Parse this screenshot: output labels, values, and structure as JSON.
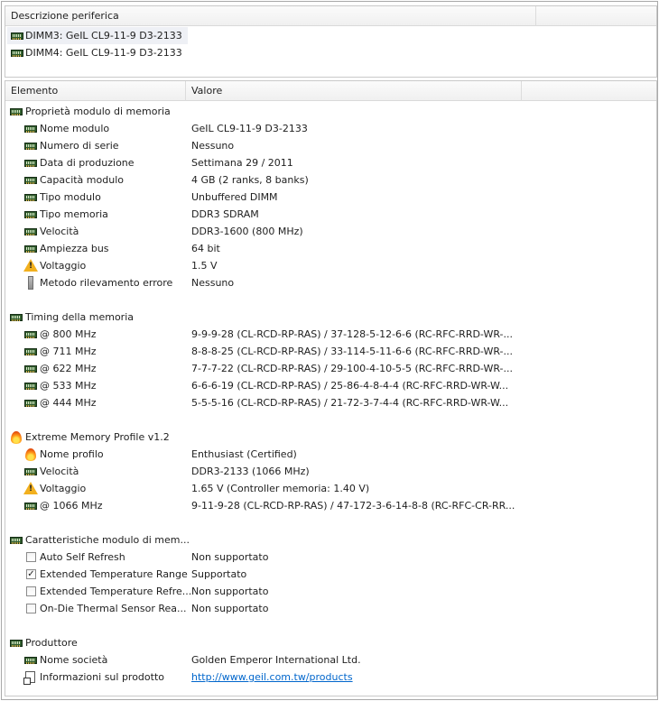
{
  "device_pane": {
    "header": "Descrizione periferica",
    "devices": [
      "DIMM3: GeIL CL9-11-9 D3-2133",
      "DIMM4: GeIL CL9-11-9 D3-2133"
    ]
  },
  "list_pane": {
    "headers": {
      "element": "Elemento",
      "value": "Valore"
    },
    "sections": [
      {
        "title": "Proprietà modulo di memoria",
        "icon": "memory-module-icon",
        "rows": [
          {
            "label": "Nome modulo",
            "value": "GeIL CL9-11-9 D3-2133",
            "icon": "memory-module-icon"
          },
          {
            "label": "Numero di serie",
            "value": "Nessuno",
            "icon": "memory-module-icon"
          },
          {
            "label": "Data di produzione",
            "value": "Settimana 29 / 2011",
            "icon": "memory-module-icon"
          },
          {
            "label": "Capacità modulo",
            "value": "4 GB (2 ranks, 8 banks)",
            "icon": "memory-module-icon"
          },
          {
            "label": "Tipo modulo",
            "value": "Unbuffered DIMM",
            "icon": "memory-module-icon"
          },
          {
            "label": "Tipo memoria",
            "value": "DDR3 SDRAM",
            "icon": "memory-module-icon"
          },
          {
            "label": "Velocità",
            "value": "DDR3-1600 (800 MHz)",
            "icon": "memory-module-icon"
          },
          {
            "label": "Ampiezza bus",
            "value": "64 bit",
            "icon": "memory-module-icon"
          },
          {
            "label": "Voltaggio",
            "value": "1.5 V",
            "icon": "warning-icon"
          },
          {
            "label": "Metodo rilevamento errore",
            "value": "Nessuno",
            "icon": "pencil-icon"
          }
        ]
      },
      {
        "title": "Timing della memoria",
        "icon": "memory-module-icon",
        "rows": [
          {
            "label": "@ 800 MHz",
            "value": "9-9-9-28  (CL-RCD-RP-RAS) / 37-128-5-12-6-6  (RC-RFC-RRD-WR-...",
            "icon": "memory-module-icon"
          },
          {
            "label": "@ 711 MHz",
            "value": "8-8-8-25  (CL-RCD-RP-RAS) / 33-114-5-11-6-6  (RC-RFC-RRD-WR-...",
            "icon": "memory-module-icon"
          },
          {
            "label": "@ 622 MHz",
            "value": "7-7-7-22  (CL-RCD-RP-RAS) / 29-100-4-10-5-5  (RC-RFC-RRD-WR-...",
            "icon": "memory-module-icon"
          },
          {
            "label": "@ 533 MHz",
            "value": "6-6-6-19  (CL-RCD-RP-RAS) / 25-86-4-8-4-4  (RC-RFC-RRD-WR-W...",
            "icon": "memory-module-icon"
          },
          {
            "label": "@ 444 MHz",
            "value": "5-5-5-16  (CL-RCD-RP-RAS) / 21-72-3-7-4-4  (RC-RFC-RRD-WR-W...",
            "icon": "memory-module-icon"
          }
        ]
      },
      {
        "title": "Extreme Memory Profile v1.2",
        "icon": "flame-icon",
        "rows": [
          {
            "label": "Nome profilo",
            "value": "Enthusiast (Certified)",
            "icon": "flame-icon"
          },
          {
            "label": "Velocità",
            "value": "DDR3-2133 (1066 MHz)",
            "icon": "memory-module-icon"
          },
          {
            "label": "Voltaggio",
            "value": "1.65 V  (Controller memoria: 1.40 V)",
            "icon": "warning-icon"
          },
          {
            "label": "@ 1066 MHz",
            "value": "9-11-9-28  (CL-RCD-RP-RAS) / 47-172-3-6-14-8-8  (RC-RFC-CR-RR...",
            "icon": "memory-module-icon"
          }
        ]
      },
      {
        "title": "Caratteristiche modulo di mem...",
        "icon": "memory-module-icon",
        "rows": [
          {
            "label": "Auto Self Refresh",
            "value": "Non supportato",
            "icon": "checkbox-unchecked-icon"
          },
          {
            "label": "Extended Temperature Range",
            "value": "Supportato",
            "icon": "checkbox-checked-icon"
          },
          {
            "label": "Extended Temperature Refre...",
            "value": "Non supportato",
            "icon": "checkbox-unchecked-icon"
          },
          {
            "label": "On-Die Thermal Sensor Rea...",
            "value": "Non supportato",
            "icon": "checkbox-unchecked-icon"
          }
        ]
      },
      {
        "title": "Produttore",
        "icon": "memory-module-icon",
        "rows": [
          {
            "label": "Nome società",
            "value": "Golden Emperor International Ltd.",
            "icon": "memory-module-icon"
          },
          {
            "label": "Informazioni sul prodotto",
            "value": "http://www.geil.com.tw/products",
            "icon": "document-link-icon",
            "link": true
          }
        ]
      }
    ]
  }
}
